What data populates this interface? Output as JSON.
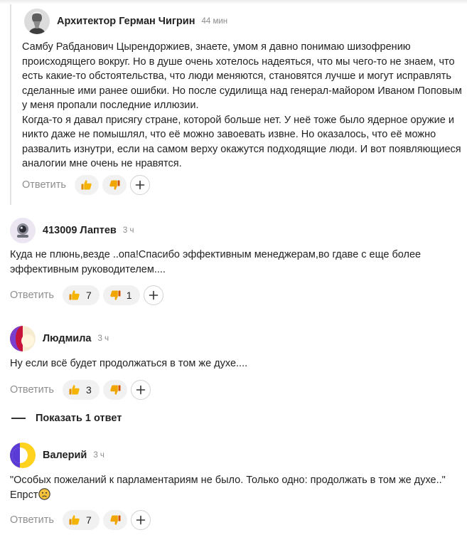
{
  "common": {
    "reply_label": "Ответить",
    "show_replies_label": "Показать 1 ответ"
  },
  "comments": [
    {
      "author": "Архитектор Герман Чигрин",
      "time": "44 мин",
      "paragraphs": [
        "Самбу Рабданович Цырендоржиев, знаете, умом я давно понимаю шизофрению происходящего вокруг. Но в душе очень хотелось надеяться, что мы чего-то не знаем, что есть какие-то обстоятельства, что люди меняются, становятся лучше и могут исправлять сделанные ими ранее ошибки. Но после судилища над генерал-майором Иваном Поповым у меня пропали последние иллюзии.",
        "Когда-то я давал присягу стране, которой больше нет. У неё тоже было ядерное оружие и никто даже не помышлял, что её можно завоевать извне. Но оказалось, что её можно развалить изнутри, если на самом верху окажутся подходящие люди. И вот появляющиеся аналогии мне очень не нравятся."
      ],
      "likes": "",
      "dislikes": ""
    },
    {
      "author": "413009 Лаптев",
      "time": "3 ч",
      "paragraphs": [
        "Куда не плюнь,везде ..опа!Спасибо эффективным менеджерам,во гдаве с еще более эффективным руководителем...."
      ],
      "likes": "7",
      "dislikes": "1"
    },
    {
      "author": "Людмила",
      "time": "3 ч",
      "paragraphs": [
        "Ну если всё будет продолжаться в том же духе...."
      ],
      "likes": "3",
      "dislikes": ""
    },
    {
      "author": "Валерий",
      "time": "3 ч",
      "paragraphs": [
        "\"Особых пожеланий к парламентариям не было. Только одно: продолжать в том же духе..\" Епрст"
      ],
      "likes": "7",
      "dislikes": ""
    }
  ],
  "colors": {
    "like": "#f5b400",
    "dislike": "#f0a500",
    "avatar_violet": "#5b3bd6",
    "avatar_yellow": "#ffd21e"
  }
}
